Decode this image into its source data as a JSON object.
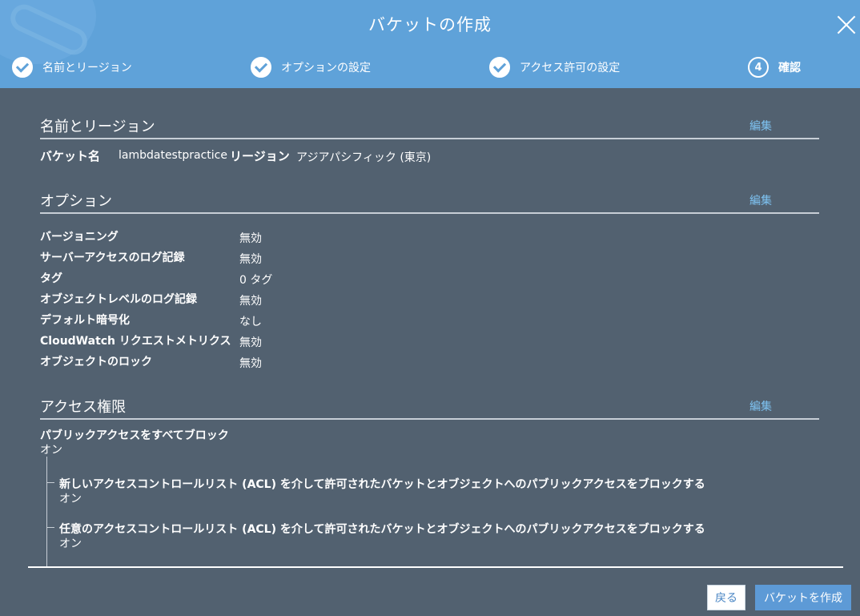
{
  "dialog": {
    "title": "バケットの作成",
    "steps": [
      {
        "label": "名前とリージョン",
        "done": true
      },
      {
        "label": "オプションの設定",
        "done": true
      },
      {
        "label": "アクセス許可の設定",
        "done": true
      },
      {
        "label": "確認",
        "number": "4",
        "current": true
      }
    ]
  },
  "name_region": {
    "heading": "名前とリージョン",
    "edit": "編集",
    "bucket_name_label": "バケット名",
    "bucket_name_value": "lambdatestpractice",
    "region_label": "リージョン",
    "region_value": "アジアパシフィック (東京)"
  },
  "options": {
    "heading": "オプション",
    "edit": "編集",
    "items": [
      {
        "label": "バージョニング",
        "value": "無効"
      },
      {
        "label": "サーバーアクセスのログ記録",
        "value": "無効"
      },
      {
        "label": "タグ",
        "value": "0 タグ"
      },
      {
        "label": "オブジェクトレベルのログ記録",
        "value": "無効"
      },
      {
        "label": "デフォルト暗号化",
        "value": "なし"
      },
      {
        "label": "CloudWatch リクエストメトリクス",
        "value": "無効"
      },
      {
        "label": "オブジェクトのロック",
        "value": "無効"
      }
    ]
  },
  "access": {
    "heading": "アクセス権限",
    "edit": "編集",
    "block_all_label": "パブリックアクセスをすべてブロック",
    "block_all_value": "オン",
    "sub_items": [
      {
        "label": "新しいアクセスコントロールリスト (ACL) を介して許可されたバケットとオブジェクトへのパブリックアクセスをブロックする",
        "value": "オン"
      },
      {
        "label": "任意のアクセスコントロールリスト (ACL) を介して許可されたバケットとオブジェクトへのパブリックアクセスをブロックする",
        "value": "オン"
      }
    ]
  },
  "footer": {
    "back": "戻る",
    "create": "バケットを作成"
  }
}
